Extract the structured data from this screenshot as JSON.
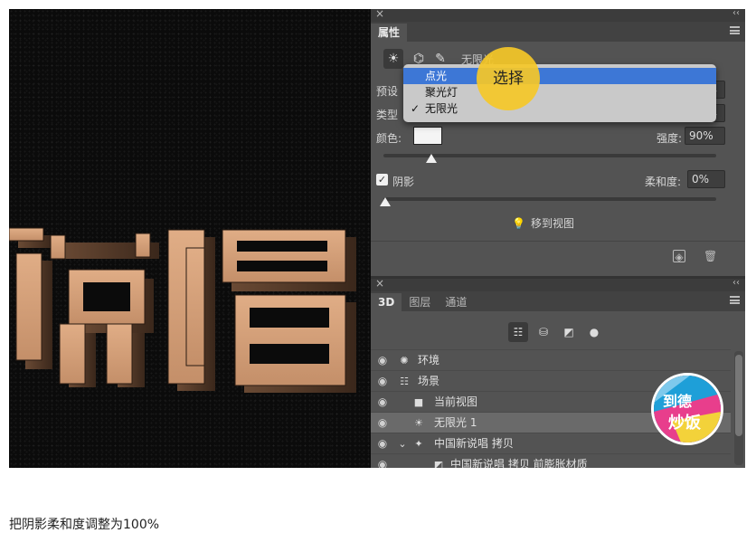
{
  "caption": "把阴影柔和度调整为100%",
  "canvas": {
    "text_3d": "说唱",
    "background_color": "#0b0b0b",
    "text_color": "#d6a37c"
  },
  "properties_panel": {
    "close_glyph": "×",
    "collapse_glyph": "‹‹",
    "tab_title": "属性",
    "light_type_current": "无限光",
    "preset_label": "预设",
    "type_label": "类型",
    "color_label": "颜色:",
    "intensity_label": "强度:",
    "intensity_value": "90%",
    "intensity_fraction": 0.9,
    "shadow_checkbox_label": "阴影",
    "shadow_checked": true,
    "softness_label": "柔和度:",
    "softness_value": "0%",
    "softness_fraction": 0.0,
    "move_to_view_label": "移到视图",
    "dropdown": {
      "items": [
        {
          "label": "点光",
          "highlighted": true,
          "checked": false
        },
        {
          "label": "聚光灯",
          "highlighted": false,
          "checked": false
        },
        {
          "label": "无限光",
          "highlighted": false,
          "checked": true
        }
      ]
    },
    "callout_text": "选择",
    "highlight_color": "#3d77d6",
    "callout_color": "#f5c828"
  },
  "layers_panel": {
    "close_glyph": "×",
    "collapse_glyph": "‹‹",
    "tabs": [
      {
        "label": "3D",
        "active": true
      },
      {
        "label": "图层",
        "active": false
      },
      {
        "label": "通道",
        "active": false
      }
    ],
    "layers": [
      {
        "label": "环境",
        "selected": false
      },
      {
        "label": "场景",
        "selected": false
      },
      {
        "label": "当前视图",
        "selected": false
      },
      {
        "label": "无限光 1",
        "selected": true
      },
      {
        "label": "中国新说唱 拷贝",
        "selected": false
      },
      {
        "label": "中国新说唱 拷贝 前膨胀材质",
        "selected": false
      }
    ]
  },
  "watermark": {
    "text": "到德 炒饭"
  }
}
